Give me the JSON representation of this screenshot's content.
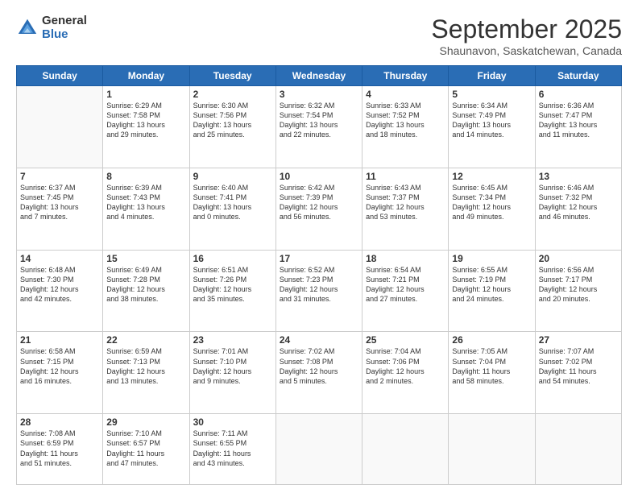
{
  "logo": {
    "general": "General",
    "blue": "Blue"
  },
  "title": "September 2025",
  "location": "Shaunavon, Saskatchewan, Canada",
  "days_of_week": [
    "Sunday",
    "Monday",
    "Tuesday",
    "Wednesday",
    "Thursday",
    "Friday",
    "Saturday"
  ],
  "weeks": [
    [
      {
        "day": "",
        "info": ""
      },
      {
        "day": "1",
        "info": "Sunrise: 6:29 AM\nSunset: 7:58 PM\nDaylight: 13 hours\nand 29 minutes."
      },
      {
        "day": "2",
        "info": "Sunrise: 6:30 AM\nSunset: 7:56 PM\nDaylight: 13 hours\nand 25 minutes."
      },
      {
        "day": "3",
        "info": "Sunrise: 6:32 AM\nSunset: 7:54 PM\nDaylight: 13 hours\nand 22 minutes."
      },
      {
        "day": "4",
        "info": "Sunrise: 6:33 AM\nSunset: 7:52 PM\nDaylight: 13 hours\nand 18 minutes."
      },
      {
        "day": "5",
        "info": "Sunrise: 6:34 AM\nSunset: 7:49 PM\nDaylight: 13 hours\nand 14 minutes."
      },
      {
        "day": "6",
        "info": "Sunrise: 6:36 AM\nSunset: 7:47 PM\nDaylight: 13 hours\nand 11 minutes."
      }
    ],
    [
      {
        "day": "7",
        "info": "Sunrise: 6:37 AM\nSunset: 7:45 PM\nDaylight: 13 hours\nand 7 minutes."
      },
      {
        "day": "8",
        "info": "Sunrise: 6:39 AM\nSunset: 7:43 PM\nDaylight: 13 hours\nand 4 minutes."
      },
      {
        "day": "9",
        "info": "Sunrise: 6:40 AM\nSunset: 7:41 PM\nDaylight: 13 hours\nand 0 minutes."
      },
      {
        "day": "10",
        "info": "Sunrise: 6:42 AM\nSunset: 7:39 PM\nDaylight: 12 hours\nand 56 minutes."
      },
      {
        "day": "11",
        "info": "Sunrise: 6:43 AM\nSunset: 7:37 PM\nDaylight: 12 hours\nand 53 minutes."
      },
      {
        "day": "12",
        "info": "Sunrise: 6:45 AM\nSunset: 7:34 PM\nDaylight: 12 hours\nand 49 minutes."
      },
      {
        "day": "13",
        "info": "Sunrise: 6:46 AM\nSunset: 7:32 PM\nDaylight: 12 hours\nand 46 minutes."
      }
    ],
    [
      {
        "day": "14",
        "info": "Sunrise: 6:48 AM\nSunset: 7:30 PM\nDaylight: 12 hours\nand 42 minutes."
      },
      {
        "day": "15",
        "info": "Sunrise: 6:49 AM\nSunset: 7:28 PM\nDaylight: 12 hours\nand 38 minutes."
      },
      {
        "day": "16",
        "info": "Sunrise: 6:51 AM\nSunset: 7:26 PM\nDaylight: 12 hours\nand 35 minutes."
      },
      {
        "day": "17",
        "info": "Sunrise: 6:52 AM\nSunset: 7:23 PM\nDaylight: 12 hours\nand 31 minutes."
      },
      {
        "day": "18",
        "info": "Sunrise: 6:54 AM\nSunset: 7:21 PM\nDaylight: 12 hours\nand 27 minutes."
      },
      {
        "day": "19",
        "info": "Sunrise: 6:55 AM\nSunset: 7:19 PM\nDaylight: 12 hours\nand 24 minutes."
      },
      {
        "day": "20",
        "info": "Sunrise: 6:56 AM\nSunset: 7:17 PM\nDaylight: 12 hours\nand 20 minutes."
      }
    ],
    [
      {
        "day": "21",
        "info": "Sunrise: 6:58 AM\nSunset: 7:15 PM\nDaylight: 12 hours\nand 16 minutes."
      },
      {
        "day": "22",
        "info": "Sunrise: 6:59 AM\nSunset: 7:13 PM\nDaylight: 12 hours\nand 13 minutes."
      },
      {
        "day": "23",
        "info": "Sunrise: 7:01 AM\nSunset: 7:10 PM\nDaylight: 12 hours\nand 9 minutes."
      },
      {
        "day": "24",
        "info": "Sunrise: 7:02 AM\nSunset: 7:08 PM\nDaylight: 12 hours\nand 5 minutes."
      },
      {
        "day": "25",
        "info": "Sunrise: 7:04 AM\nSunset: 7:06 PM\nDaylight: 12 hours\nand 2 minutes."
      },
      {
        "day": "26",
        "info": "Sunrise: 7:05 AM\nSunset: 7:04 PM\nDaylight: 11 hours\nand 58 minutes."
      },
      {
        "day": "27",
        "info": "Sunrise: 7:07 AM\nSunset: 7:02 PM\nDaylight: 11 hours\nand 54 minutes."
      }
    ],
    [
      {
        "day": "28",
        "info": "Sunrise: 7:08 AM\nSunset: 6:59 PM\nDaylight: 11 hours\nand 51 minutes."
      },
      {
        "day": "29",
        "info": "Sunrise: 7:10 AM\nSunset: 6:57 PM\nDaylight: 11 hours\nand 47 minutes."
      },
      {
        "day": "30",
        "info": "Sunrise: 7:11 AM\nSunset: 6:55 PM\nDaylight: 11 hours\nand 43 minutes."
      },
      {
        "day": "",
        "info": ""
      },
      {
        "day": "",
        "info": ""
      },
      {
        "day": "",
        "info": ""
      },
      {
        "day": "",
        "info": ""
      }
    ]
  ]
}
